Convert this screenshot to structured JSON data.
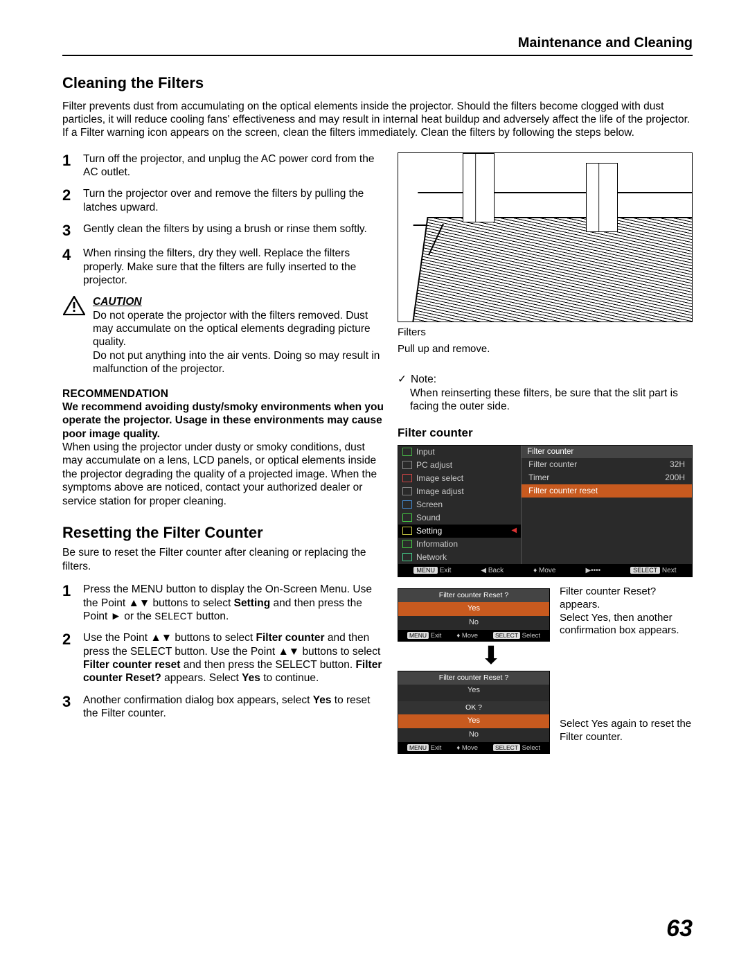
{
  "breadcrumb": "Maintenance and Cleaning",
  "page_number": "63",
  "section_cleaning": {
    "heading": "Cleaning the Filters",
    "intro": "Filter prevents dust from accumulating on the optical elements inside the projector. Should the filters become clogged with dust particles, it will reduce cooling fans' effectiveness and may result in internal heat buildup and adversely affect the life of the projector. If a Filter warning icon appears on the screen, clean the filters immediately. Clean the filters by following the steps below.",
    "steps": [
      {
        "num": "1",
        "text": "Turn off the projector, and unplug the AC power cord from the AC outlet."
      },
      {
        "num": "2",
        "text": "Turn the projector over and remove the filters by pulling the latches upward."
      },
      {
        "num": "3",
        "text": "Gently clean the filters by using a brush or rinse them softly."
      },
      {
        "num": "4",
        "text": "When rinsing the filters, dry they well. Replace the filters properly. Make sure that the filters are fully inserted to the projector."
      }
    ],
    "caution": {
      "head": "CAUTION",
      "p1": "Do not operate the projector with the filters removed. Dust may accumulate on the optical elements degrading picture quality.",
      "p2": "Do not put anything into the air vents. Doing so may result in malfunction of the projector."
    },
    "reco": {
      "head": "RECOMMENDATION",
      "bold": "We recommend avoiding dusty/smoky environments when you operate the projector. Usage in these environments may cause poor image quality.",
      "text": "When using the projector under dusty or smoky conditions, dust may accumulate on a lens, LCD panels, or optical elements inside the projector degrading the quality of a projected image. When the symptoms above are noticed, contact your authorized dealer or service station for proper cleaning."
    },
    "figure": {
      "label1": "Filters",
      "label2": "Pull up and remove."
    },
    "note": {
      "head": "Note:",
      "text": "When reinserting these filters, be sure that the slit part is facing the outer side."
    }
  },
  "section_reset": {
    "heading": "Resetting the Filter Counter",
    "intro": "Be sure to reset the Filter counter after cleaning or replacing the filters.",
    "steps": [
      {
        "num": "1",
        "pre": "Press the MENU button to display the On-Screen Menu. Use the Point ▲▼ buttons to select ",
        "b1": "Setting",
        "mid": " and then press the Point ► or the ",
        "small": "SELECT",
        "post": " button."
      },
      {
        "num": "2",
        "pre": "Use the Point ▲▼ buttons to select ",
        "b1": "Filter counter",
        "mid": " and then press the SELECT button. Use the Point ▲▼ buttons to select ",
        "b2": "Filter counter reset",
        "mid2": " and then press the SELECT button. ",
        "b3": "Filter counter Reset?",
        "post": " appears. Select ",
        "b4": "Yes",
        "post2": " to continue."
      },
      {
        "num": "3",
        "pre": "Another confirmation dialog box appears, select ",
        "b1": "Yes",
        "post": " to reset the Filter counter."
      }
    ],
    "subhead": "Filter counter",
    "osd": {
      "title_right": "Filter counter",
      "left_menu": [
        "Input",
        "PC adjust",
        "Image select",
        "Image adjust",
        "Screen",
        "Sound",
        "Setting",
        "Information",
        "Network"
      ],
      "selected_left": "Setting",
      "right_items": [
        {
          "label": "Filter counter",
          "value": "32H"
        },
        {
          "label": "Timer",
          "value": "200H"
        },
        {
          "label": "Filter counter reset",
          "value": "",
          "highlight": true
        }
      ],
      "footer": {
        "exit": "Exit",
        "back": "Back",
        "move": "Move",
        "next": "Next",
        "k_menu": "MENU",
        "k_select": "SELECT"
      }
    },
    "dialog1": {
      "title": "Filter counter Reset ?",
      "opts": [
        "Yes",
        "No"
      ],
      "hi_index": 0,
      "footer": {
        "exit": "Exit",
        "move": "Move",
        "select": "Select",
        "k_menu": "MENU",
        "k_select": "SELECT"
      }
    },
    "dialog1_caption": "Filter counter Reset? appears.\nSelect Yes, then another confirmation box appears.",
    "dialog2": {
      "title": "Filter counter Reset ?",
      "line_yes": "Yes",
      "ok": "OK ?",
      "opts": [
        "Yes",
        "No"
      ],
      "hi_index": 0,
      "footer": {
        "exit": "Exit",
        "move": "Move",
        "select": "Select",
        "k_menu": "MENU",
        "k_select": "SELECT"
      }
    },
    "dialog2_caption": "Select Yes again to reset  the Filter counter."
  }
}
